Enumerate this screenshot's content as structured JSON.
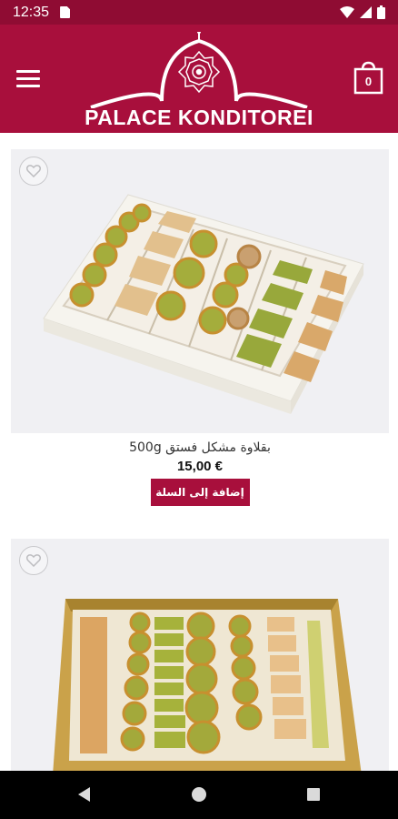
{
  "status_bar": {
    "time": "12:35"
  },
  "header": {
    "brand": "PALACE KONDITOREI",
    "cart_count": "0"
  },
  "products": [
    {
      "title": "بقلاوة مشكل فستق 500g",
      "price": "15,00 €",
      "add_label": "إضافة إلى السلة"
    },
    {
      "title": "",
      "price": "",
      "add_label": ""
    }
  ],
  "colors": {
    "primary": "#a80f3c",
    "status_bar": "#8f0c33",
    "nav_bar": "#000000"
  }
}
